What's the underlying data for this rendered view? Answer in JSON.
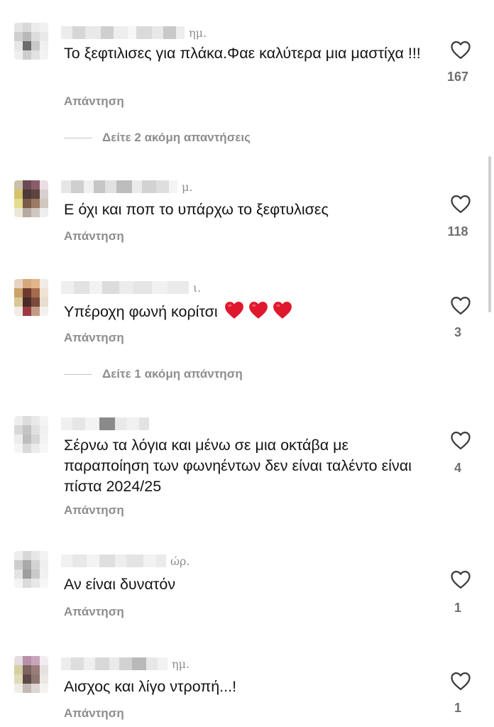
{
  "comments": [
    {
      "time": "ημ.",
      "text": "Το ξεφτιλισες για πλάκα.Φαε καλύτερα μια μαστίχα !!!",
      "likes": "167",
      "reply": "Απάντηση",
      "more_replies": "Δείτε 2 ακόμη απαντήσεις"
    },
    {
      "time": "μ.",
      "text": "Ε όχι και ποπ το υπάρχω το ξεφτυλισες",
      "likes": "118",
      "reply": "Απάντηση"
    },
    {
      "time": "ι.",
      "text": "Υπέροχη φωνή κορίτσι",
      "emoji": "heart-emoji x3",
      "likes": "3",
      "reply": "Απάντηση",
      "more_replies": "Δείτε 1 ακόμη απάντηση"
    },
    {
      "time": "",
      "text": "Σέρνω τα λόγια και μένω σε μια οκτάβα με παραποίηση των φωνηέντων δεν είναι ταλέντο είναι πίστα 2024/25",
      "likes": "4",
      "reply": "Απάντηση"
    },
    {
      "time": "ώρ.",
      "text": "Αν είναι δυνατόν",
      "likes": "1",
      "reply": "Απάντηση"
    },
    {
      "time": "ημ.",
      "text": "Αισχος και λίγο ντροπή...!",
      "likes": "1",
      "reply": "Απάντηση"
    }
  ],
  "icons": {
    "like": "heart-outline-icon",
    "emoji": "red-heart-emoji"
  },
  "colors": {
    "secondary_text": "#8e8e8e",
    "emoji_heart": "#e0182d"
  }
}
